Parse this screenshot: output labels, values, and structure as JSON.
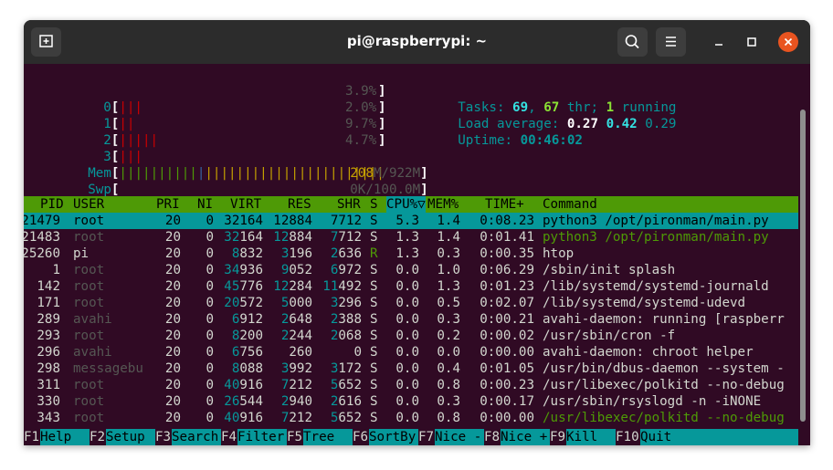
{
  "window": {
    "title": "pi@raspberrypi: ~"
  },
  "cpu": [
    {
      "label": "0",
      "bars": "|||",
      "pct": "3.9%"
    },
    {
      "label": "1",
      "bars": "||",
      "pct": "2.0%"
    },
    {
      "label": "2",
      "bars": "|||||",
      "pct": "9.7%"
    },
    {
      "label": "3",
      "bars": "|||",
      "pct": "4.7%"
    }
  ],
  "mem": {
    "label": "Mem",
    "bars": "||||||||||||||||||||||||||||||||||",
    "used": "208",
    "total": "M/922M"
  },
  "swp": {
    "label": "Swp",
    "value": "0K/100.0M"
  },
  "summary": {
    "tasks_label": "Tasks:",
    "tasks": "69",
    "thr": "67",
    "thr_label": " thr;",
    "running": "1",
    "running_label": " running",
    "load_label": "Load average:",
    "load1": "0.27",
    "load5": "0.42",
    "load15": "0.29",
    "uptime_label": "Uptime:",
    "uptime": "00:46:02"
  },
  "columns": [
    "PID",
    "USER",
    "PRI",
    "NI",
    "VIRT",
    "RES",
    "SHR",
    "S",
    "CPU%▽",
    "MEM%",
    "TIME+",
    "Command"
  ],
  "processes": [
    {
      "pid": "21479",
      "user": "root",
      "pri": "20",
      "ni": "0",
      "virt": "32164",
      "res": "12884",
      "shr": "7712",
      "s": "S",
      "cpu": "5.3",
      "mem": "1.4",
      "time": "0:08.23",
      "cmd": "python3 /opt/pironman/main.py"
    },
    {
      "pid": "21483",
      "user": "root",
      "pri": "20",
      "ni": "0",
      "virt": "32164",
      "res": "12884",
      "shr": "7712",
      "s": "S",
      "cpu": "1.3",
      "mem": "1.4",
      "time": "0:01.41",
      "cmd": "python3 /opt/pironman/main.py"
    },
    {
      "pid": "25260",
      "user": "pi",
      "pri": "20",
      "ni": "0",
      "virt": "8832",
      "res": "3196",
      "shr": "2636",
      "s": "R",
      "cpu": "1.3",
      "mem": "0.3",
      "time": "0:00.35",
      "cmd": "htop"
    },
    {
      "pid": "1",
      "user": "root",
      "pri": "20",
      "ni": "0",
      "virt": "34936",
      "res": "9052",
      "shr": "6972",
      "s": "S",
      "cpu": "0.0",
      "mem": "1.0",
      "time": "0:06.29",
      "cmd": "/sbin/init splash"
    },
    {
      "pid": "142",
      "user": "root",
      "pri": "20",
      "ni": "0",
      "virt": "45776",
      "res": "12284",
      "shr": "11492",
      "s": "S",
      "cpu": "0.0",
      "mem": "1.3",
      "time": "0:01.23",
      "cmd": "/lib/systemd/systemd-journald"
    },
    {
      "pid": "171",
      "user": "root",
      "pri": "20",
      "ni": "0",
      "virt": "20572",
      "res": "5000",
      "shr": "3296",
      "s": "S",
      "cpu": "0.0",
      "mem": "0.5",
      "time": "0:02.07",
      "cmd": "/lib/systemd/systemd-udevd"
    },
    {
      "pid": "289",
      "user": "avahi",
      "pri": "20",
      "ni": "0",
      "virt": "6912",
      "res": "2648",
      "shr": "2388",
      "s": "S",
      "cpu": "0.0",
      "mem": "0.3",
      "time": "0:00.21",
      "cmd": "avahi-daemon: running [raspberr"
    },
    {
      "pid": "293",
      "user": "root",
      "pri": "20",
      "ni": "0",
      "virt": "8200",
      "res": "2244",
      "shr": "2068",
      "s": "S",
      "cpu": "0.0",
      "mem": "0.2",
      "time": "0:00.02",
      "cmd": "/usr/sbin/cron -f"
    },
    {
      "pid": "296",
      "user": "avahi",
      "pri": "20",
      "ni": "0",
      "virt": "6756",
      "res": "260",
      "shr": "0",
      "s": "S",
      "cpu": "0.0",
      "mem": "0.0",
      "time": "0:00.00",
      "cmd": "avahi-daemon: chroot helper"
    },
    {
      "pid": "298",
      "user": "messagebu",
      "pri": "20",
      "ni": "0",
      "virt": "8088",
      "res": "3992",
      "shr": "3172",
      "s": "S",
      "cpu": "0.0",
      "mem": "0.4",
      "time": "0:01.05",
      "cmd": "/usr/bin/dbus-daemon --system -"
    },
    {
      "pid": "311",
      "user": "root",
      "pri": "20",
      "ni": "0",
      "virt": "40916",
      "res": "7212",
      "shr": "5652",
      "s": "S",
      "cpu": "0.0",
      "mem": "0.8",
      "time": "0:00.23",
      "cmd": "/usr/libexec/polkitd --no-debug"
    },
    {
      "pid": "330",
      "user": "root",
      "pri": "20",
      "ni": "0",
      "virt": "26544",
      "res": "2940",
      "shr": "2616",
      "s": "S",
      "cpu": "0.0",
      "mem": "0.3",
      "time": "0:00.17",
      "cmd": "/usr/sbin/rsyslogd -n -iNONE"
    },
    {
      "pid": "343",
      "user": "root",
      "pri": "20",
      "ni": "0",
      "virt": "40916",
      "res": "7212",
      "shr": "5652",
      "s": "S",
      "cpu": "0.0",
      "mem": "0.8",
      "time": "0:00.00",
      "cmd": "/usr/libexec/polkitd --no-debug"
    }
  ],
  "function_keys": [
    {
      "key": "F1",
      "label": "Help"
    },
    {
      "key": "F2",
      "label": "Setup"
    },
    {
      "key": "F3",
      "label": "Search"
    },
    {
      "key": "F4",
      "label": "Filter"
    },
    {
      "key": "F5",
      "label": "Tree"
    },
    {
      "key": "F6",
      "label": "SortBy"
    },
    {
      "key": "F7",
      "label": "Nice -"
    },
    {
      "key": "F8",
      "label": "Nice +"
    },
    {
      "key": "F9",
      "label": "Kill"
    },
    {
      "key": "F10",
      "label": "Quit"
    }
  ],
  "colors": {
    "terminal_bg": "#300a24",
    "header_bg": "#4e9a06",
    "selection_bg": "#06989a",
    "close_button": "#e95420"
  }
}
